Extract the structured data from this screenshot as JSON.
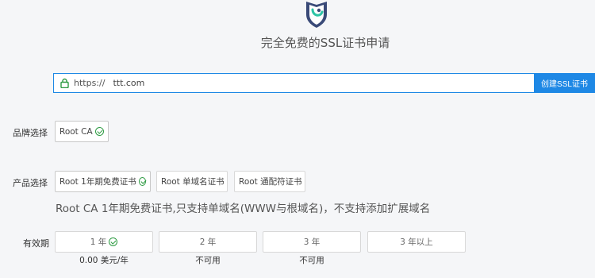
{
  "page": {
    "subtitle": "完全免费的SSL证书申请"
  },
  "search": {
    "prefix": "https://",
    "value": "ttt.com",
    "button_label": "创建SSL证书"
  },
  "brand": {
    "label": "品牌选择",
    "options": [
      {
        "label": "Root CA",
        "selected": true
      }
    ]
  },
  "product": {
    "label": "产品选择",
    "options": [
      {
        "label": "Root 1年期免费证书",
        "selected": true
      },
      {
        "label": "Root 单域名证书",
        "selected": false
      },
      {
        "label": "Root 通配符证书",
        "selected": false
      }
    ],
    "description": "Root CA 1年期免费证书,只支持单域名(WWW与根域名)，不支持添加扩展域名"
  },
  "validity": {
    "label": "有效期",
    "options": [
      {
        "label": "1 年",
        "selected": true,
        "price": "0.00 美元/年"
      },
      {
        "label": "2 年",
        "selected": false,
        "price": "不可用"
      },
      {
        "label": "3 年",
        "selected": false,
        "price": "不可用"
      },
      {
        "label": "3 年以上",
        "selected": false,
        "price": ""
      }
    ]
  },
  "colors": {
    "accent": "#1e88e5",
    "check": "#2e9b43",
    "logo_primary": "#2b3a67",
    "logo_accent": "#2ec4a6"
  }
}
